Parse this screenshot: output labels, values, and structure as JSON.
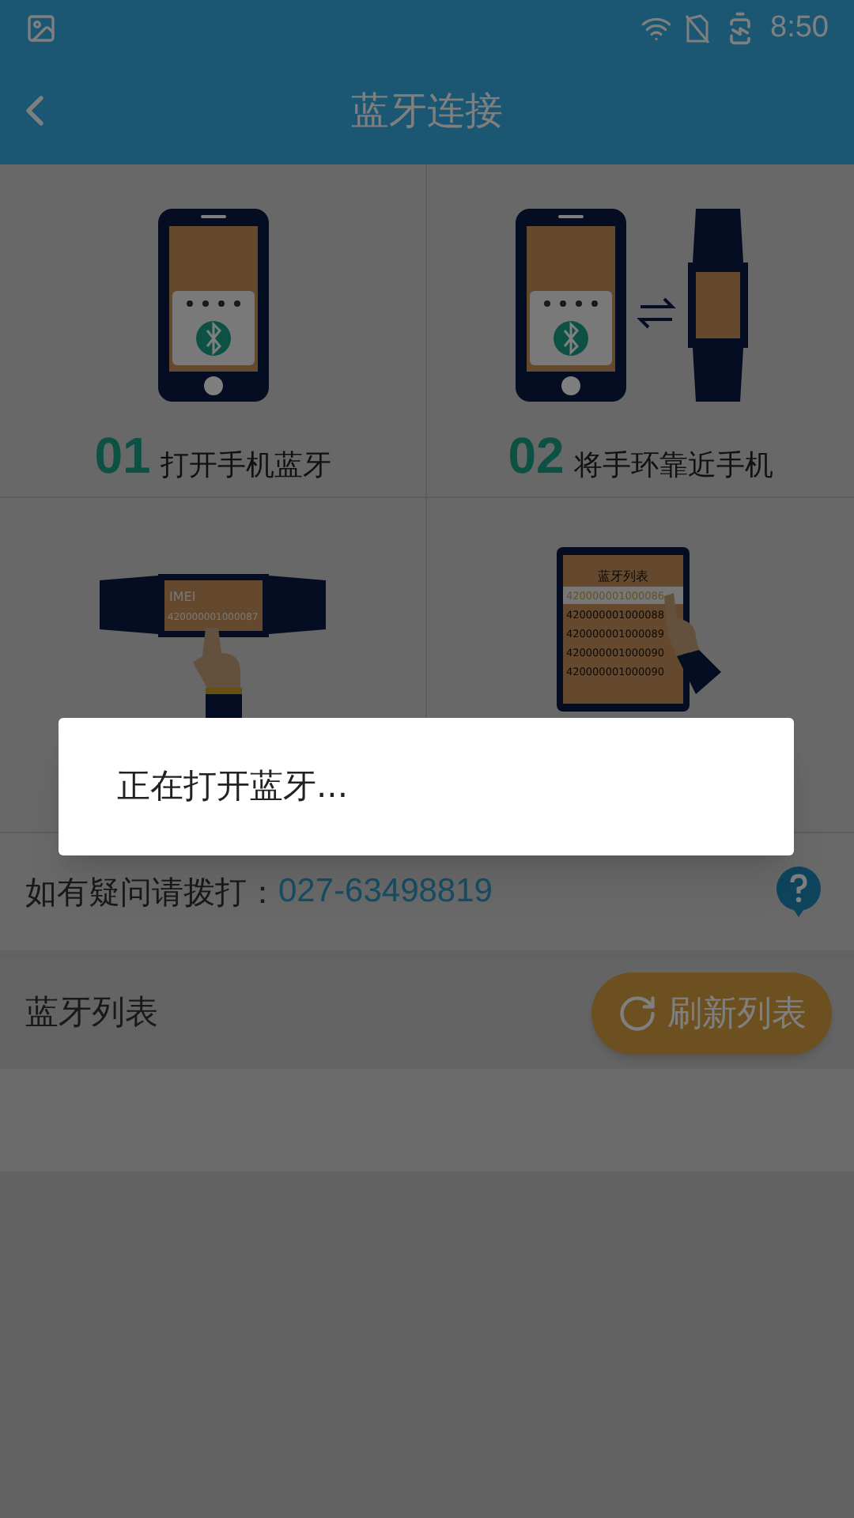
{
  "status_bar": {
    "time": "8:50"
  },
  "header": {
    "title": "蓝牙连接"
  },
  "steps": [
    {
      "kind": "phone",
      "number": "01",
      "caption": "打开手机蓝牙"
    },
    {
      "kind": "phone_band",
      "number": "02",
      "caption": "将手环靠近手机"
    },
    {
      "kind": "band",
      "screen_title": "IMEI",
      "screen_code": "420000001000087"
    },
    {
      "kind": "list",
      "list_title": "蓝牙列表",
      "list_rows": [
        {
          "text": "420000001000086",
          "selected": true
        },
        {
          "text": "420000001000088",
          "selected": false
        },
        {
          "text": "420000001000089",
          "selected": false
        },
        {
          "text": "420000001000090",
          "selected": false
        },
        {
          "text": "420000001000090",
          "selected": false
        }
      ]
    }
  ],
  "hotline": {
    "label": "如有疑问请拨打：",
    "number": "027-63498819"
  },
  "bluetooth_list": {
    "title": "蓝牙列表",
    "refresh_button": "刷新列表"
  },
  "dialog": {
    "message": "正在打开蓝牙..."
  }
}
